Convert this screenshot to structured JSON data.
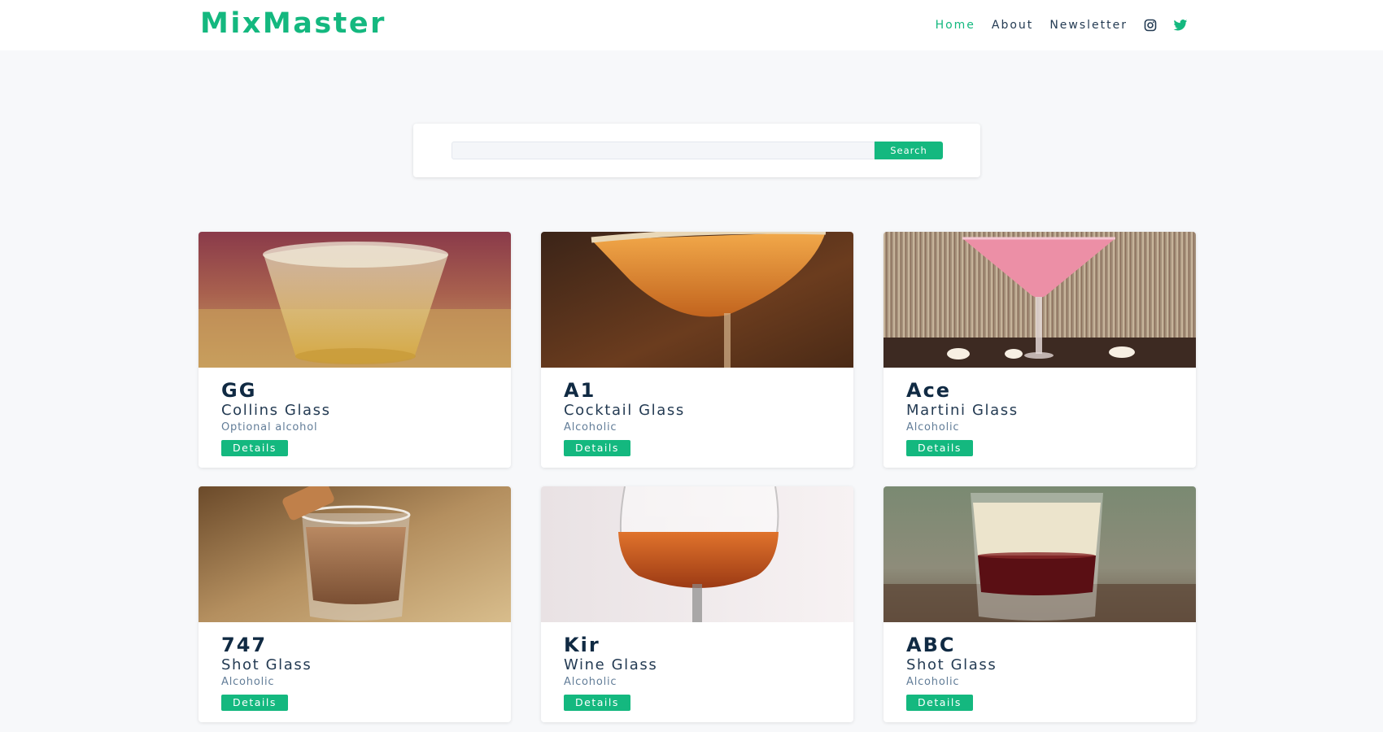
{
  "brand": {
    "logo_text": "MixMaster",
    "accent": "#14b87f"
  },
  "nav": {
    "links": [
      {
        "label": "Home",
        "active": true
      },
      {
        "label": "About",
        "active": false
      },
      {
        "label": "Newsletter",
        "active": false
      }
    ],
    "social_icons": [
      "instagram-icon",
      "twitter-icon"
    ]
  },
  "search": {
    "input_value": "",
    "placeholder": "",
    "button_label": "Search"
  },
  "cocktails": [
    {
      "name": "GG",
      "glass": "Collins Glass",
      "info": "Optional alcohol",
      "button_label": "Details",
      "image": "collins-glass-photo"
    },
    {
      "name": "A1",
      "glass": "Cocktail Glass",
      "info": "Alcoholic",
      "button_label": "Details",
      "image": "cocktail-glass-photo"
    },
    {
      "name": "Ace",
      "glass": "Martini Glass",
      "info": "Alcoholic",
      "button_label": "Details",
      "image": "martini-glass-photo"
    },
    {
      "name": "747",
      "glass": "Shot Glass",
      "info": "Alcoholic",
      "button_label": "Details",
      "image": "shot-glass-photo"
    },
    {
      "name": "Kir",
      "glass": "Wine Glass",
      "info": "Alcoholic",
      "button_label": "Details",
      "image": "wine-glass-photo"
    },
    {
      "name": "ABC",
      "glass": "Shot Glass",
      "info": "Alcoholic",
      "button_label": "Details",
      "image": "layered-shot-photo"
    }
  ]
}
